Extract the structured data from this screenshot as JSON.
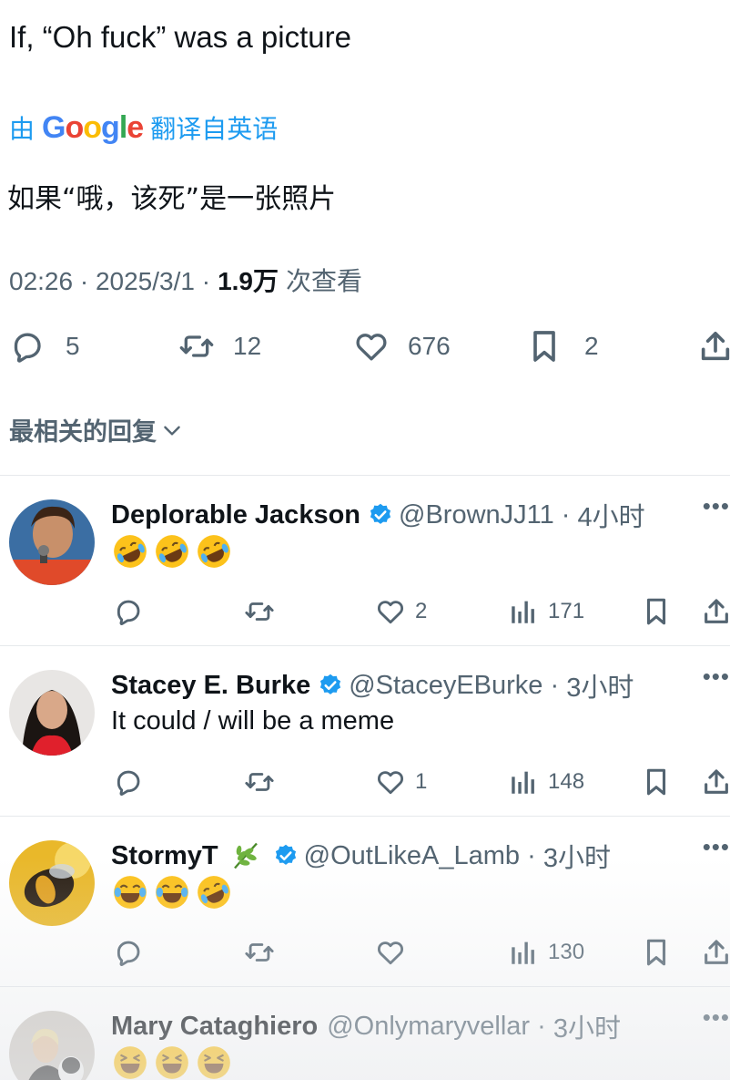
{
  "tweet": {
    "text": "If, “Oh fuck” was a picture",
    "translate_prefix": "由",
    "translate_suffix": "翻译自英语",
    "translated_text": "如果“哦，该死”是一张照片",
    "time": "02:26",
    "date": "2025/3/1",
    "views": "1.9万",
    "views_label": "次查看"
  },
  "actions": {
    "replies": "5",
    "retweets": "12",
    "likes": "676",
    "bookmarks": "2"
  },
  "sort_label": "最相关的回复",
  "replies": [
    {
      "name": "Deplorable Jackson",
      "handle": "@BrownJJ11",
      "time": "4小时",
      "emojis": [
        "rofl",
        "rofl",
        "rofl"
      ],
      "likes": "2",
      "views": "171"
    },
    {
      "name": "Stacey E. Burke",
      "handle": "@StaceyEBurke",
      "time": "3小时",
      "text": "It could / will be a meme",
      "likes": "1",
      "views": "148"
    },
    {
      "name": "StormyT",
      "handle": "@OutLikeA_Lamb",
      "time": "3小时",
      "emojis": [
        "joy",
        "joy",
        "rofl"
      ],
      "likes": "",
      "views": "130"
    },
    {
      "name": "Mary Cataghiero",
      "handle": "@Onlymaryvellar",
      "time": "3小时",
      "emojis": [
        "laughing",
        "laughing",
        "laughing"
      ]
    }
  ],
  "colors": {
    "text": "#0f1419",
    "secondary": "#536471",
    "link": "#1d9bf0",
    "verified": "#1d9bf0"
  }
}
